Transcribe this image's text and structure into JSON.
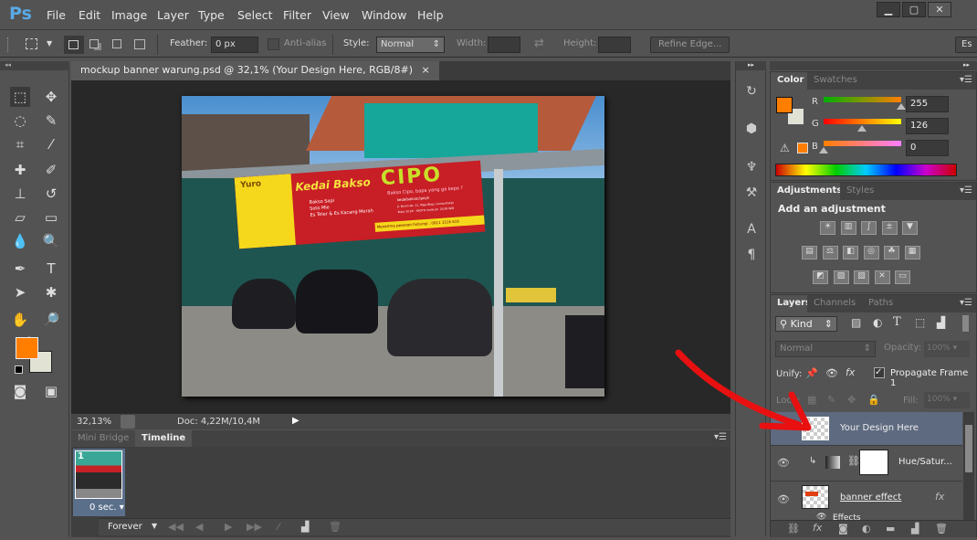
{
  "app": {
    "logo": "Ps",
    "menus": [
      "File",
      "Edit",
      "Image",
      "Layer",
      "Type",
      "Select",
      "Filter",
      "View",
      "Window",
      "Help"
    ],
    "window_controls": [
      "minimize",
      "restore",
      "close"
    ]
  },
  "options": {
    "feather_label": "Feather:",
    "feather_value": "0 px",
    "antialias_label": "Anti-alias",
    "style_label": "Style:",
    "style_value": "Normal",
    "width_label": "Width:",
    "height_label": "Height:",
    "refine_edge": "Refine Edge...",
    "workspace": "Es"
  },
  "document": {
    "tab_title": "mockup banner warung.psd @ 32,1% (Your Design Here, RGB/8#)",
    "close": "×",
    "zoom": "32,13%",
    "doc_size": "Doc: 4,22M/10,4M",
    "banner": {
      "brand": "Yuro",
      "title": "Kedai Bakso",
      "name": "CIPO",
      "tagline": "Bakso Cipo, bapa yang ga kepo ?",
      "items": [
        "Bakso Sapi",
        "Soto Mie",
        "Es Teler & Es Kacang Merah"
      ],
      "instagram": "kedaibaksocipoyk",
      "address": "Jl. Berlin No. 11, Maja Blaju, Lembuthanjo",
      "hours": "Buka 10.00 - SAOTO malai pk. 20.00 WIB",
      "order": "Menerima pesanan hubungi : 0811 1516 816"
    }
  },
  "timeline": {
    "tabs": [
      "Mini Bridge",
      "Timeline"
    ],
    "active_tab": "Timeline",
    "frame_number": "1",
    "frame_delay": "0 sec.",
    "loop": "Forever"
  },
  "color_panel": {
    "tabs": [
      "Color",
      "Swatches"
    ],
    "active": "Color",
    "foreground": "#ff7e00",
    "background": "#e1e2d4",
    "channels": [
      {
        "label": "R",
        "value": "255",
        "fraction": 1.0
      },
      {
        "label": "G",
        "value": "126",
        "fraction": 0.49
      },
      {
        "label": "B",
        "value": "0",
        "fraction": 0.0
      }
    ]
  },
  "adjustments_panel": {
    "tabs": [
      "Adjustments",
      "Styles"
    ],
    "active": "Adjustments",
    "heading": "Add an adjustment",
    "icons": [
      [
        "brightness-contrast",
        "levels",
        "curves",
        "exposure",
        "vibrance"
      ],
      [
        "hue-saturation",
        "color-balance",
        "black-white",
        "photo-filter",
        "channel-mixer",
        "color-lookup"
      ],
      [
        "invert",
        "posterize",
        "threshold",
        "selective-color",
        "gradient-map"
      ]
    ]
  },
  "layers_panel": {
    "tabs": [
      "Layers",
      "Channels",
      "Paths"
    ],
    "active": "Layers",
    "filter": "Kind",
    "blend_mode": "Normal",
    "opacity_label": "Opacity:",
    "opacity": "100%",
    "unify_label": "Unify:",
    "propagate_label": "Propagate Frame 1",
    "propagate_checked": true,
    "lock_label": "Lock:",
    "fill_label": "Fill:",
    "fill": "100%",
    "layers": [
      {
        "name": "Your Design Here",
        "visible": false,
        "selected": true,
        "type": "smart-object"
      },
      {
        "name": "Hue/Satur...",
        "visible": true,
        "type": "adjustment",
        "clipped": true
      },
      {
        "name": "banner effect",
        "visible": true,
        "type": "smart-object",
        "fx": "fx",
        "effects_label": "Effects"
      }
    ]
  },
  "annotation": {
    "arrow_color": "#e81010"
  }
}
